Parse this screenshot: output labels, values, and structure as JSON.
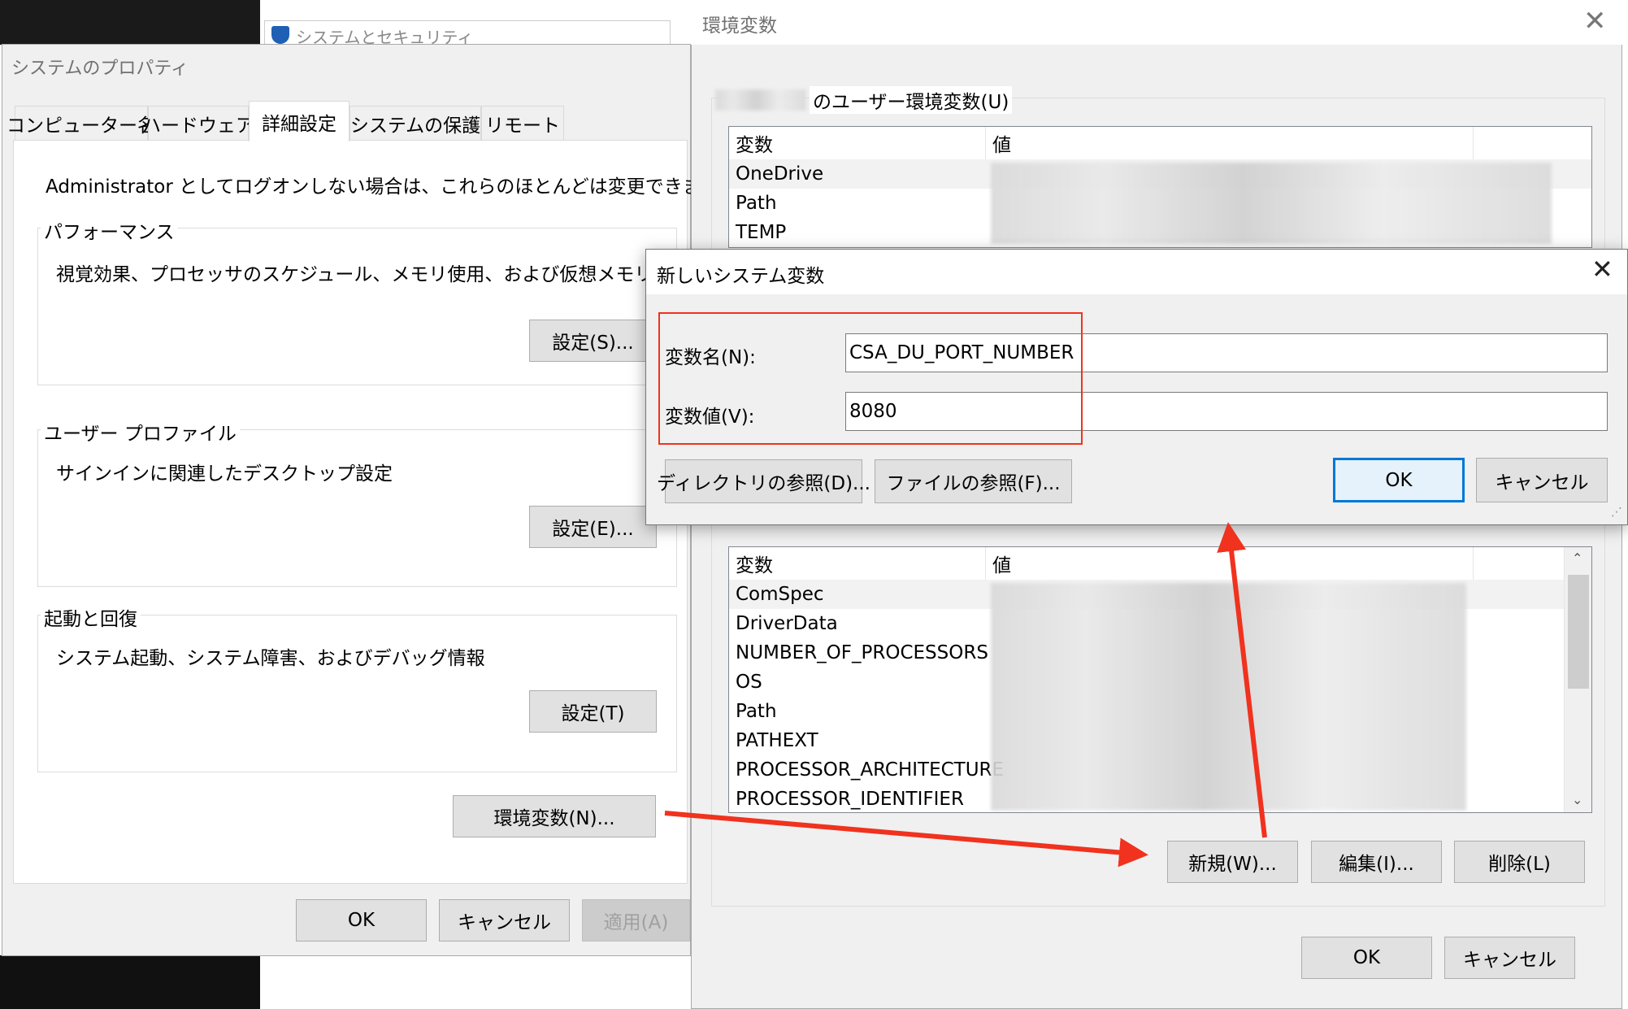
{
  "background": {
    "security_window_title": "システムとセキュリティ"
  },
  "sysprop": {
    "title": "システムのプロパティ",
    "tabs": [
      "コンピューター名",
      "ハードウェア",
      "詳細設定",
      "システムの保護",
      "リモート"
    ],
    "admin_note": "Administrator としてログオンしない場合は、これらのほとんどは変更できません。",
    "performance": {
      "legend": "パフォーマンス",
      "desc": "視覚効果、プロセッサのスケジュール、メモリ使用、および仮想メモリ",
      "button": "設定(S)..."
    },
    "profile": {
      "legend": "ユーザー プロファイル",
      "desc": "サインインに関連したデスクトップ設定",
      "button": "設定(E)..."
    },
    "startup": {
      "legend": "起動と回復",
      "desc": "システム起動、システム障害、およびデバッグ情報",
      "button": "設定(T)"
    },
    "env_button": "環境変数(N)...",
    "ok": "OK",
    "cancel": "キャンセル",
    "apply": "適用(A)"
  },
  "envvars": {
    "title": "環境変数",
    "user_group_label": "のユーザー環境変数(U)",
    "col_var": "変数",
    "col_val": "値",
    "user_vars": [
      "OneDrive",
      "Path",
      "TEMP"
    ],
    "system_vars": [
      "ComSpec",
      "DriverData",
      "NUMBER_OF_PROCESSORS",
      "OS",
      "Path",
      "PATHEXT",
      "PROCESSOR_ARCHITECTURE",
      "PROCESSOR_IDENTIFIER"
    ],
    "new_button": "新規(W)...",
    "edit_button": "編集(I)...",
    "delete_button": "削除(L)",
    "ok": "OK",
    "cancel": "キャンセル"
  },
  "newvar": {
    "title": "新しいシステム変数",
    "name_label": "変数名(N):",
    "value_label": "変数値(V):",
    "name_value": "CSA_DU_PORT_NUMBER",
    "value_value": "8080",
    "browse_dir": "ディレクトリの参照(D)...",
    "browse_file": "ファイルの参照(F)...",
    "ok": "OK",
    "cancel": "キャンセル"
  },
  "colors": {
    "annotation": "#f0321e",
    "focus_blue": "#0078d7"
  }
}
